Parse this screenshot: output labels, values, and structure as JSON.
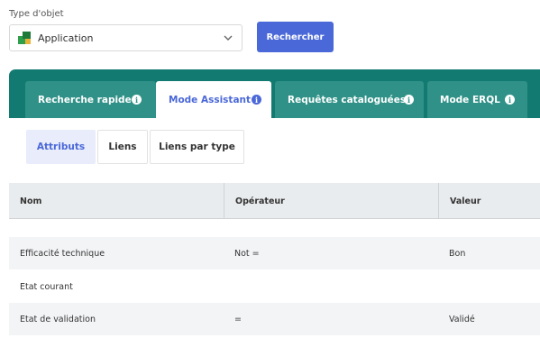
{
  "object_type": {
    "label": "Type d'objet",
    "selected": "Application"
  },
  "search_button": "Rechercher",
  "tabs": [
    {
      "label": "Recherche rapide",
      "active": false
    },
    {
      "label": "Mode Assistant",
      "active": true
    },
    {
      "label": "Requêtes cataloguées",
      "active": false
    },
    {
      "label": "Mode ERQL",
      "active": false
    }
  ],
  "subtabs": [
    {
      "label": "Attributs",
      "active": true
    },
    {
      "label": "Liens",
      "active": false
    },
    {
      "label": "Liens par type",
      "active": false
    }
  ],
  "table": {
    "columns": [
      "Nom",
      "Opérateur",
      "Valeur"
    ],
    "rows": [
      {
        "nom": "Efficacité technique",
        "operateur": "Not =",
        "valeur": "Bon"
      },
      {
        "nom": "Etat courant",
        "operateur": "",
        "valeur": ""
      },
      {
        "nom": "Etat de validation",
        "operateur": "=",
        "valeur": "Validé"
      }
    ]
  },
  "colors": {
    "primary": "#4a68d8",
    "tab_bar": "#127a70",
    "tab_inactive": "#2f9187",
    "subtab_active_bg": "#e8ecfb"
  }
}
